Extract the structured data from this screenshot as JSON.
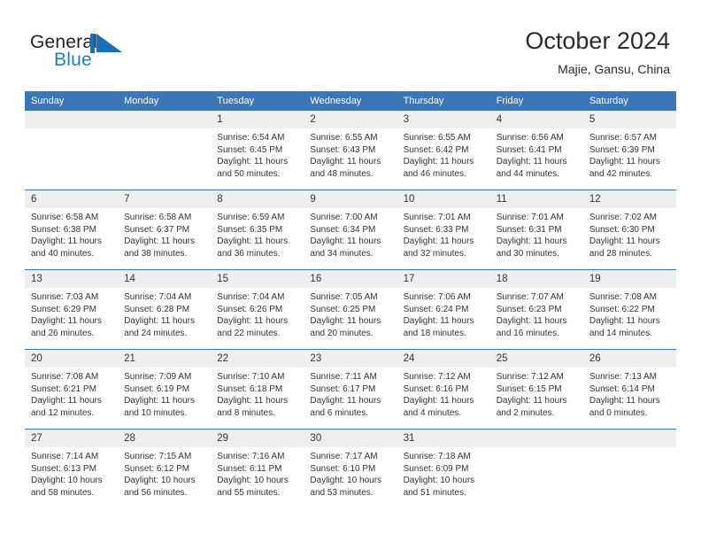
{
  "brand": {
    "name_top": "General",
    "name_bottom": "Blue",
    "accent_color": "#1a7fc1",
    "logo_mark": "triangle-flag-mark"
  },
  "header": {
    "title": "October 2024",
    "subtitle": "Majie, Gansu, China"
  },
  "colors": {
    "header_blue": "#3a76b8",
    "daynum_band": "#efefef",
    "text": "#333333"
  },
  "weekday_headers": [
    "Sunday",
    "Monday",
    "Tuesday",
    "Wednesday",
    "Thursday",
    "Friday",
    "Saturday"
  ],
  "labels": {
    "sunrise": "Sunrise:",
    "sunset": "Sunset:",
    "daylight": "Daylight:"
  },
  "weeks": [
    [
      {
        "day": ""
      },
      {
        "day": ""
      },
      {
        "day": "1",
        "sunrise": "Sunrise: 6:54 AM",
        "sunset": "Sunset: 6:45 PM",
        "daylight1": "Daylight: 11 hours",
        "daylight2": "and 50 minutes."
      },
      {
        "day": "2",
        "sunrise": "Sunrise: 6:55 AM",
        "sunset": "Sunset: 6:43 PM",
        "daylight1": "Daylight: 11 hours",
        "daylight2": "and 48 minutes."
      },
      {
        "day": "3",
        "sunrise": "Sunrise: 6:55 AM",
        "sunset": "Sunset: 6:42 PM",
        "daylight1": "Daylight: 11 hours",
        "daylight2": "and 46 minutes."
      },
      {
        "day": "4",
        "sunrise": "Sunrise: 6:56 AM",
        "sunset": "Sunset: 6:41 PM",
        "daylight1": "Daylight: 11 hours",
        "daylight2": "and 44 minutes."
      },
      {
        "day": "5",
        "sunrise": "Sunrise: 6:57 AM",
        "sunset": "Sunset: 6:39 PM",
        "daylight1": "Daylight: 11 hours",
        "daylight2": "and 42 minutes."
      }
    ],
    [
      {
        "day": "6",
        "sunrise": "Sunrise: 6:58 AM",
        "sunset": "Sunset: 6:38 PM",
        "daylight1": "Daylight: 11 hours",
        "daylight2": "and 40 minutes."
      },
      {
        "day": "7",
        "sunrise": "Sunrise: 6:58 AM",
        "sunset": "Sunset: 6:37 PM",
        "daylight1": "Daylight: 11 hours",
        "daylight2": "and 38 minutes."
      },
      {
        "day": "8",
        "sunrise": "Sunrise: 6:59 AM",
        "sunset": "Sunset: 6:35 PM",
        "daylight1": "Daylight: 11 hours",
        "daylight2": "and 36 minutes."
      },
      {
        "day": "9",
        "sunrise": "Sunrise: 7:00 AM",
        "sunset": "Sunset: 6:34 PM",
        "daylight1": "Daylight: 11 hours",
        "daylight2": "and 34 minutes."
      },
      {
        "day": "10",
        "sunrise": "Sunrise: 7:01 AM",
        "sunset": "Sunset: 6:33 PM",
        "daylight1": "Daylight: 11 hours",
        "daylight2": "and 32 minutes."
      },
      {
        "day": "11",
        "sunrise": "Sunrise: 7:01 AM",
        "sunset": "Sunset: 6:31 PM",
        "daylight1": "Daylight: 11 hours",
        "daylight2": "and 30 minutes."
      },
      {
        "day": "12",
        "sunrise": "Sunrise: 7:02 AM",
        "sunset": "Sunset: 6:30 PM",
        "daylight1": "Daylight: 11 hours",
        "daylight2": "and 28 minutes."
      }
    ],
    [
      {
        "day": "13",
        "sunrise": "Sunrise: 7:03 AM",
        "sunset": "Sunset: 6:29 PM",
        "daylight1": "Daylight: 11 hours",
        "daylight2": "and 26 minutes."
      },
      {
        "day": "14",
        "sunrise": "Sunrise: 7:04 AM",
        "sunset": "Sunset: 6:28 PM",
        "daylight1": "Daylight: 11 hours",
        "daylight2": "and 24 minutes."
      },
      {
        "day": "15",
        "sunrise": "Sunrise: 7:04 AM",
        "sunset": "Sunset: 6:26 PM",
        "daylight1": "Daylight: 11 hours",
        "daylight2": "and 22 minutes."
      },
      {
        "day": "16",
        "sunrise": "Sunrise: 7:05 AM",
        "sunset": "Sunset: 6:25 PM",
        "daylight1": "Daylight: 11 hours",
        "daylight2": "and 20 minutes."
      },
      {
        "day": "17",
        "sunrise": "Sunrise: 7:06 AM",
        "sunset": "Sunset: 6:24 PM",
        "daylight1": "Daylight: 11 hours",
        "daylight2": "and 18 minutes."
      },
      {
        "day": "18",
        "sunrise": "Sunrise: 7:07 AM",
        "sunset": "Sunset: 6:23 PM",
        "daylight1": "Daylight: 11 hours",
        "daylight2": "and 16 minutes."
      },
      {
        "day": "19",
        "sunrise": "Sunrise: 7:08 AM",
        "sunset": "Sunset: 6:22 PM",
        "daylight1": "Daylight: 11 hours",
        "daylight2": "and 14 minutes."
      }
    ],
    [
      {
        "day": "20",
        "sunrise": "Sunrise: 7:08 AM",
        "sunset": "Sunset: 6:21 PM",
        "daylight1": "Daylight: 11 hours",
        "daylight2": "and 12 minutes."
      },
      {
        "day": "21",
        "sunrise": "Sunrise: 7:09 AM",
        "sunset": "Sunset: 6:19 PM",
        "daylight1": "Daylight: 11 hours",
        "daylight2": "and 10 minutes."
      },
      {
        "day": "22",
        "sunrise": "Sunrise: 7:10 AM",
        "sunset": "Sunset: 6:18 PM",
        "daylight1": "Daylight: 11 hours",
        "daylight2": "and 8 minutes."
      },
      {
        "day": "23",
        "sunrise": "Sunrise: 7:11 AM",
        "sunset": "Sunset: 6:17 PM",
        "daylight1": "Daylight: 11 hours",
        "daylight2": "and 6 minutes."
      },
      {
        "day": "24",
        "sunrise": "Sunrise: 7:12 AM",
        "sunset": "Sunset: 6:16 PM",
        "daylight1": "Daylight: 11 hours",
        "daylight2": "and 4 minutes."
      },
      {
        "day": "25",
        "sunrise": "Sunrise: 7:12 AM",
        "sunset": "Sunset: 6:15 PM",
        "daylight1": "Daylight: 11 hours",
        "daylight2": "and 2 minutes."
      },
      {
        "day": "26",
        "sunrise": "Sunrise: 7:13 AM",
        "sunset": "Sunset: 6:14 PM",
        "daylight1": "Daylight: 11 hours",
        "daylight2": "and 0 minutes."
      }
    ],
    [
      {
        "day": "27",
        "sunrise": "Sunrise: 7:14 AM",
        "sunset": "Sunset: 6:13 PM",
        "daylight1": "Daylight: 10 hours",
        "daylight2": "and 58 minutes."
      },
      {
        "day": "28",
        "sunrise": "Sunrise: 7:15 AM",
        "sunset": "Sunset: 6:12 PM",
        "daylight1": "Daylight: 10 hours",
        "daylight2": "and 56 minutes."
      },
      {
        "day": "29",
        "sunrise": "Sunrise: 7:16 AM",
        "sunset": "Sunset: 6:11 PM",
        "daylight1": "Daylight: 10 hours",
        "daylight2": "and 55 minutes."
      },
      {
        "day": "30",
        "sunrise": "Sunrise: 7:17 AM",
        "sunset": "Sunset: 6:10 PM",
        "daylight1": "Daylight: 10 hours",
        "daylight2": "and 53 minutes."
      },
      {
        "day": "31",
        "sunrise": "Sunrise: 7:18 AM",
        "sunset": "Sunset: 6:09 PM",
        "daylight1": "Daylight: 10 hours",
        "daylight2": "and 51 minutes."
      },
      {
        "day": ""
      },
      {
        "day": ""
      }
    ]
  ]
}
